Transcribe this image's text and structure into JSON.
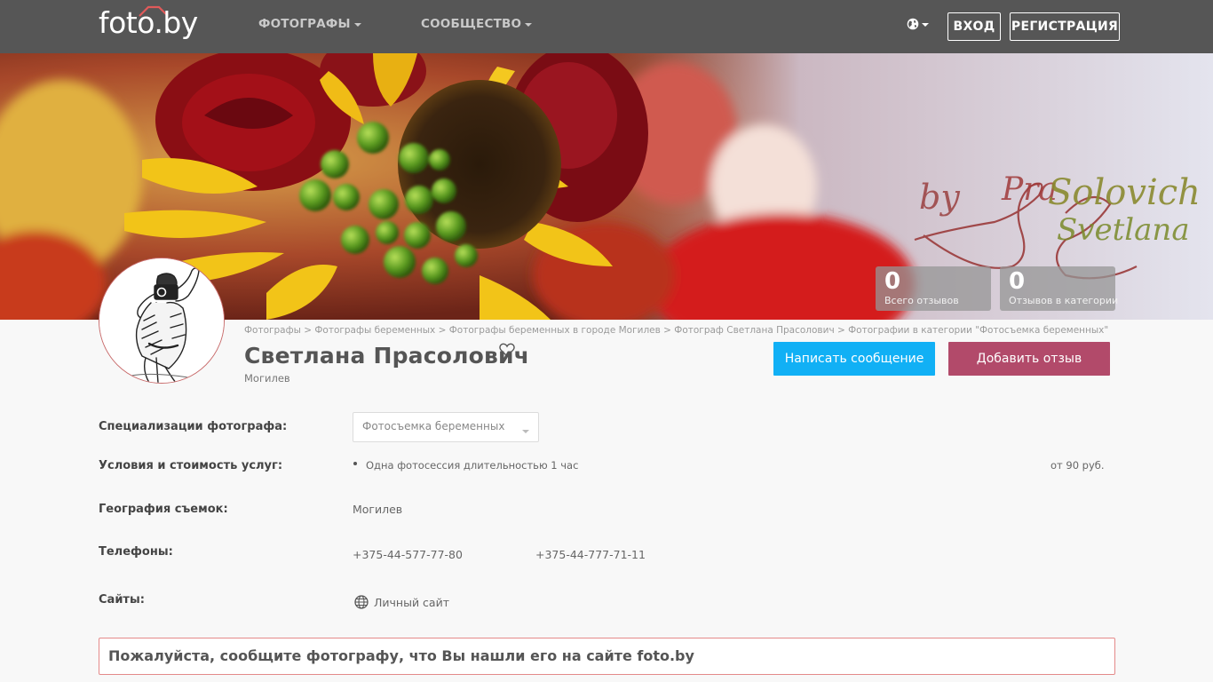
{
  "navbar": {
    "logo_text": "foto.by",
    "menu": [
      {
        "label": "ФОТОГРАФЫ"
      },
      {
        "label": "СООБЩЕСТВО"
      }
    ],
    "login_label": "ВХОД",
    "register_label": "РЕГИСТРАЦИЯ"
  },
  "hero": {
    "signature": "by Pra Solovich Svetlana",
    "stats": [
      {
        "value": "0",
        "label": "Всего отзывов"
      },
      {
        "value": "0",
        "label": "Отзывов в категории"
      }
    ]
  },
  "breadcrumb": [
    "Фотографы",
    "Фотографы беременных",
    "Фотографы беременных в городе Могилев",
    "Фотограф Светлана Прасолович",
    "Фотографии в категории \"Фотосъемка беременных\""
  ],
  "profile": {
    "name": "Светлана Прасолович",
    "city": "Могилев",
    "message_button": "Написать сообщение",
    "review_button": "Добавить отзыв"
  },
  "info": {
    "specializations_label": "Специализации фотографа:",
    "specialization_selected": "Фотосъемка беременных",
    "services_label": "Условия и стоимость услуг:",
    "service_name": "Одна фотосессия длительностью 1 час",
    "service_price": "от 90 руб.",
    "geography_label": "География съемок:",
    "geography_value": "Могилев",
    "phones_label": "Телефоны:",
    "phones": [
      "+375-44-577-77-80",
      "+375-44-777-71-11"
    ],
    "sites_label": "Сайты:",
    "site_link": "Личный сайт"
  },
  "notice": "Пожалуйста, сообщите фотографу, что Вы нашли его на сайте foto.by",
  "colors": {
    "navbar": "#565656",
    "message_button": "#11b0f5",
    "review_button": "#b24a6a",
    "notice_border": "#e48a8a"
  }
}
